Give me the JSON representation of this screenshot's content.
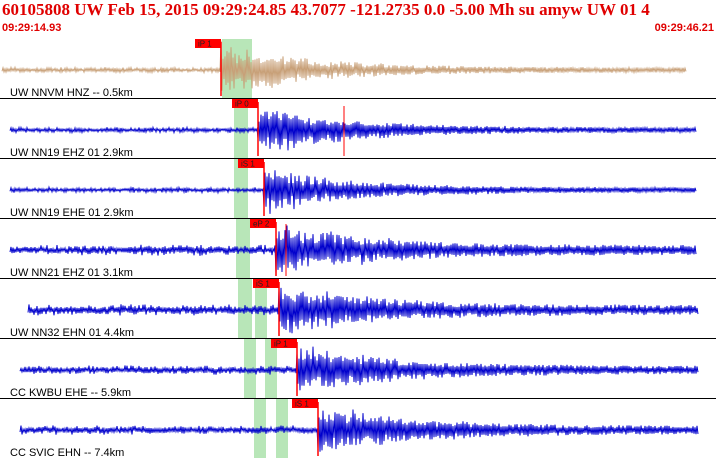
{
  "header": {
    "title": "60105808 UW Feb 15, 2015 09:29:24.85    43.7077 -121.2735  0.0 -5.00 Mh su amyw UW 01    4",
    "start_time": "09:29:14.93",
    "end_time": "09:29:46.21"
  },
  "colors": {
    "header_text": "#e00000",
    "first_trace": "#c8a078",
    "trace": "#0000cc",
    "pick": "#ff0000",
    "highlight": "#b8e6b8",
    "separator": "#000000"
  },
  "traces": [
    {
      "label": "UW NNVM HNZ -- 0.5km",
      "pick": "iP 1"
    },
    {
      "label": "UW NN19 EHZ 01 2.9km",
      "pick": "iP 0"
    },
    {
      "label": "UW NN19 EHE 01 2.9km",
      "pick": "iS 1"
    },
    {
      "label": "UW NN21 EHZ 01 3.1km",
      "pick": "eP 2"
    },
    {
      "label": "UW NN32 EHN 01 4.4km",
      "pick": "iS 1"
    },
    {
      "label": "CC KWBU EHE -- 5.9km",
      "pick": "iP 1"
    },
    {
      "label": "CC SVIC EHN -- 7.4km",
      "pick": "iS 1"
    }
  ]
}
